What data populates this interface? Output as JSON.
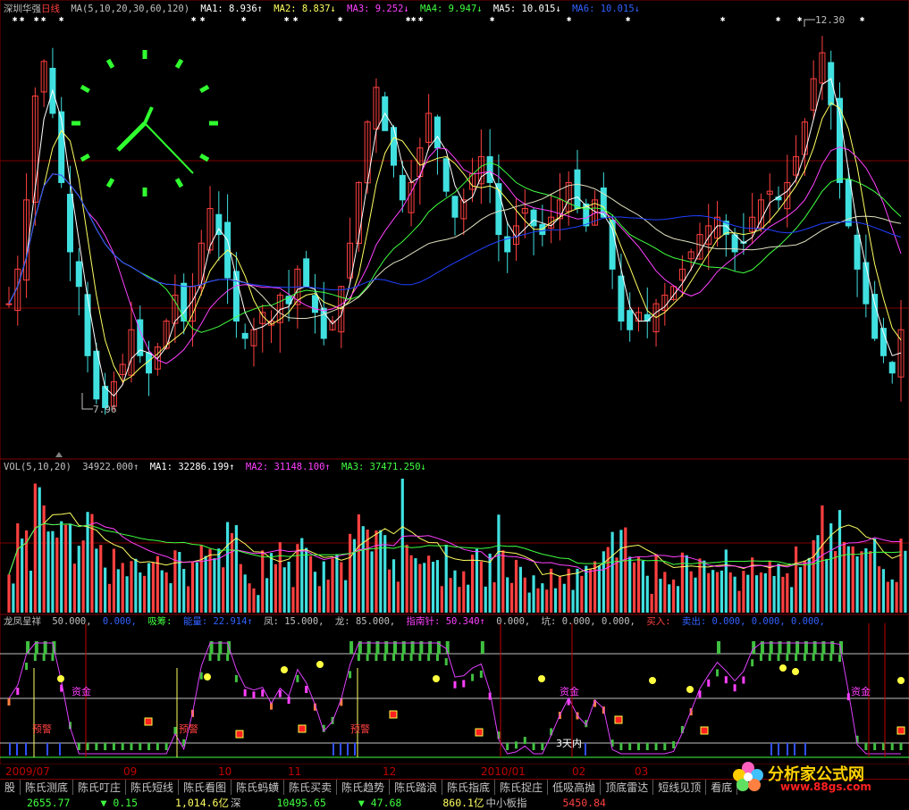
{
  "main_title": {
    "stock": "深圳华强",
    "period": "日线",
    "ma_def": "MA(5,10,20,30,60,120)",
    "ma1": "MA1: 8.936↑",
    "ma2": "MA2: 8.837↓",
    "ma3": "MA3: 9.252↓",
    "ma4": "MA4: 9.947↓",
    "ma5": "MA5: 10.015↓",
    "ma6": "MA6: 10.015↓"
  },
  "price_labels": {
    "high": "12.30",
    "low": "7.96"
  },
  "vol_title": {
    "def": "VOL(5,10,20)",
    "vol": "34922.000↑",
    "ma1": "MA1: 32286.199↑",
    "ma2": "MA2: 31148.100↑",
    "ma3": "MA3: 37471.250↓"
  },
  "ind_title": {
    "name": "龙凤呈祥",
    "v1": "50.000,",
    "v2": "0.000,",
    "xichou": "吸筹:",
    "nengliang": "能量: 22.914↑",
    "feng": "凤: 15.000,",
    "long": "龙: 85.000,",
    "zhinanzhen": "指南针: 50.340↑",
    "v3": "0.000,",
    "keng": "坑: 0.000, 0.000,",
    "mairu": "买入:",
    "maichu": "卖出: 0.000, 0.000, 0.000,"
  },
  "ind_markers": {
    "zijin": "资金",
    "yujing": "预警",
    "santian": "3天内"
  },
  "x_axis": [
    "2009/07",
    "09",
    "10",
    "11",
    "12",
    "2010/01",
    "02",
    "03"
  ],
  "tabs": [
    "股",
    "陈氏测底",
    "陈氏叮庄",
    "陈氏短线",
    "陈氏看图",
    "陈氏蚂蟥",
    "陈氏买卖",
    "陈氏趋势",
    "陈氏踏浪",
    "陈氏指底",
    "陈氏捉庄",
    "低吸高抛",
    "顶底雷达",
    "短线见顶",
    "看底"
  ],
  "status": {
    "sh_index": "2655.77",
    "sh_change": "▼ 0.15",
    "sh_amount": "1,014.6亿",
    "sz_label": "深",
    "sz_index": "10495.65",
    "sz_change": "▼ 47.68",
    "sz_amount": "860.1亿",
    "zx_label": "中小板指",
    "zx_index": "5450.84"
  },
  "logo": {
    "text": "分析家公式网",
    "url": "www.88gs.com"
  },
  "colors": {
    "up": "#ff4040",
    "down": "#40e0e0",
    "ma1": "#ffffff",
    "ma2": "#ffff60",
    "ma3": "#ff40ff",
    "ma4": "#40ff40",
    "ma5": "#ffffff",
    "ma6": "#2040ff",
    "grid": "#800000"
  },
  "chart_data": {
    "type": "candlestick",
    "price_range": [
      7.96,
      12.3
    ],
    "series_hint": "daily candles 2009/07 – 2010/03",
    "closes": [
      9.2,
      9.6,
      10.4,
      11.6,
      12.0,
      11.4,
      10.6,
      9.8,
      9.4,
      8.6,
      8.1,
      8.0,
      8.3,
      8.5,
      8.9,
      8.6,
      8.4,
      8.7,
      9.0,
      9.3,
      9.0,
      9.4,
      9.9,
      10.3,
      10.0,
      9.5,
      9.0,
      8.8,
      8.9,
      9.1,
      9.0,
      9.3,
      9.2,
      9.6,
      9.4,
      9.1,
      8.8,
      9.0,
      9.4,
      9.9,
      10.6,
      11.3,
      11.7,
      11.2,
      10.8,
      10.4,
      10.6,
      11.0,
      11.4,
      11.0,
      10.5,
      10.2,
      10.4,
      10.7,
      10.9,
      10.6,
      10.0,
      9.8,
      10.1,
      10.3,
      10.1,
      10.0,
      10.2,
      10.4,
      10.6,
      10.3,
      10.1,
      10.4,
      10.2,
      9.6,
      9.0,
      8.9,
      9.1,
      9.0,
      9.2,
      9.3,
      9.4,
      9.6,
      9.8,
      10.0,
      10.1,
      10.2,
      10.0,
      9.8,
      9.9,
      10.2,
      10.4,
      10.5,
      10.4,
      10.6,
      10.9,
      11.3,
      11.8,
      12.1,
      11.5,
      10.6,
      10.1,
      9.6,
      9.2,
      8.8,
      8.6,
      8.4,
      8.9
    ]
  }
}
